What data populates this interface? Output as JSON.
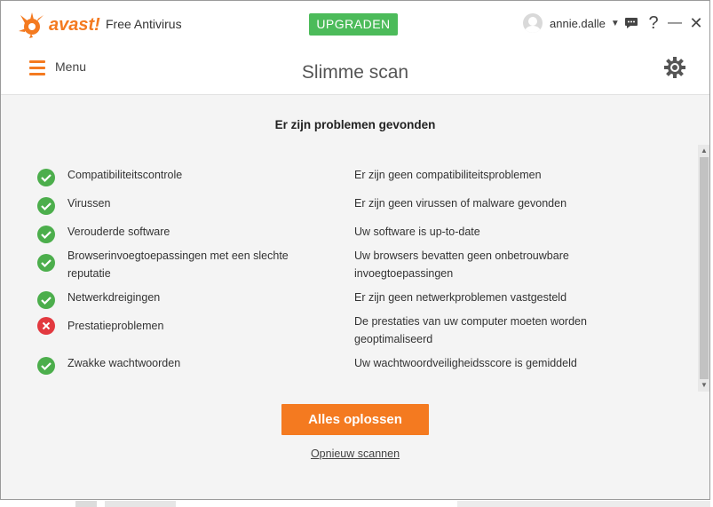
{
  "app": {
    "logo_text": "avast!",
    "product_name": "Free Antivirus",
    "upgrade_label": "UPGRADEN",
    "user_name": "annie.dalle",
    "help_label": "?",
    "minimize_label": "—",
    "close_label": "✕"
  },
  "menubar": {
    "menu_label": "Menu",
    "page_title": "Slimme scan"
  },
  "scan": {
    "heading": "Er zijn problemen gevonden",
    "rows": [
      {
        "name": "Compatibiliteitscontrole",
        "status": "ok",
        "result": "Er zijn geen compatibiliteitsproblemen"
      },
      {
        "name": "Virussen",
        "status": "ok",
        "result": "Er zijn geen virussen of malware gevonden"
      },
      {
        "name": "Verouderde software",
        "status": "ok",
        "result": "Uw software is up-to-date"
      },
      {
        "name": "Browserinvoegtoepassingen met een slechte reputatie",
        "status": "ok",
        "result": "Uw browsers bevatten geen onbetrouwbare invoegtoepassingen"
      },
      {
        "name": "Netwerkdreigingen",
        "status": "ok",
        "result": "Er zijn geen netwerkproblemen vastgesteld"
      },
      {
        "name": "Prestatieproblemen",
        "status": "error",
        "result": "De prestaties van uw computer moeten worden geoptimaliseerd"
      },
      {
        "name": "Zwakke wachtwoorden",
        "status": "ok",
        "result": "Uw wachtwoordveiligheidsscore is gemiddeld"
      }
    ],
    "fix_all_label": "Alles oplossen",
    "rescan_label": "Opnieuw scannen"
  },
  "colors": {
    "accent": "#f47a20",
    "upgrade": "#4cbb5a",
    "ok": "#4cae4c",
    "error": "#e2393f"
  },
  "icons": {
    "logo": "avast-logo-icon",
    "menu": "hamburger-icon",
    "settings": "gear-icon",
    "chat": "chat-bubble-icon",
    "ok": "checkmark-icon",
    "error": "cross-icon"
  }
}
